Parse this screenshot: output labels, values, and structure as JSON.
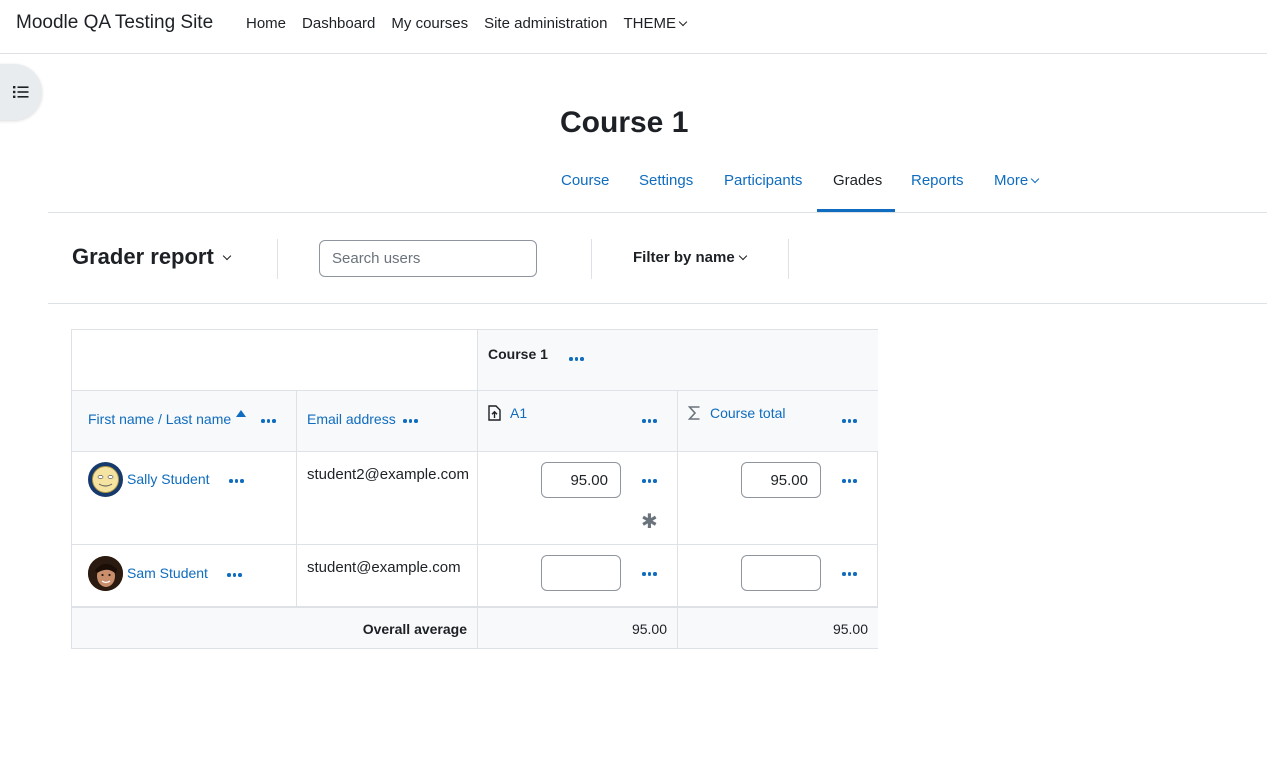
{
  "navbar": {
    "site_name": "Moodle QA Testing Site",
    "links": [
      "Home",
      "Dashboard",
      "My courses",
      "Site administration"
    ],
    "theme_label": "THEME"
  },
  "drawer_toggle_icon": "list-icon",
  "page": {
    "title": "Course 1"
  },
  "secondary_nav": {
    "tabs": [
      "Course",
      "Settings",
      "Participants",
      "Grades",
      "Reports"
    ],
    "more_label": "More",
    "active": "Grades"
  },
  "action_bar": {
    "report_selector": "Grader report",
    "search_placeholder": "Search users",
    "filter_label": "Filter by name"
  },
  "grader": {
    "category_header": "Course 1",
    "col_name_first": "First name",
    "col_name_sep": " / ",
    "col_name_last": "Last name",
    "col_email": "Email address",
    "col_a1": "A1",
    "col_total": "Course total",
    "rows": [
      {
        "name": "Sally Student",
        "email": "student2@example.com",
        "a1": "95.00",
        "total": "95.00",
        "overridden": "✱"
      },
      {
        "name": "Sam Student",
        "email": "student@example.com",
        "a1": "",
        "total": ""
      }
    ],
    "avg_label": "Overall average",
    "avg_a1": "95.00",
    "avg_total": "95.00"
  },
  "colors": {
    "link": "#0f6cbf",
    "border": "#dee2e6",
    "text": "#1d2125",
    "header_bg": "#f8f9fa"
  }
}
